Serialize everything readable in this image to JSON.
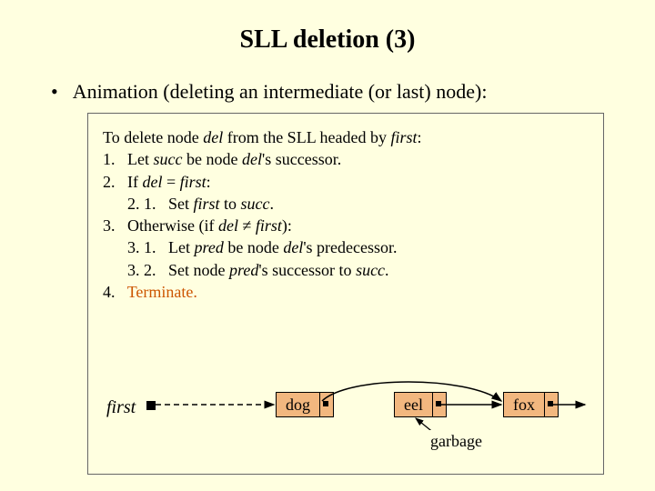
{
  "title": "SLL deletion (3)",
  "bullet": "Animation (deleting an intermediate (or last) node):",
  "algo": {
    "intro_pre": "To delete node ",
    "intro_del": "del",
    "intro_mid": " from the SLL headed by ",
    "intro_first": "first",
    "intro_post": ":",
    "l1_pre": "1.   Let ",
    "l1_succ": "succ",
    "l1_mid": " be node ",
    "l1_del": "del",
    "l1_post": "'s successor.",
    "l2_pre": "2.   If ",
    "l2_del": "del",
    "l2_eq": " = ",
    "l2_first": "first",
    "l2_post": ":",
    "l21_pre": "      2. 1.   Set ",
    "l21_first": "first",
    "l21_mid": " to ",
    "l21_succ": "succ",
    "l21_post": ".",
    "l3_pre": "3.   Otherwise (if ",
    "l3_del": "del",
    "l3_neq": " ≠ ",
    "l3_first": "first",
    "l3_post": "):",
    "l31_pre": "      3. 1.   Let ",
    "l31_pred": "pred",
    "l31_mid": " be node ",
    "l31_del": "del",
    "l31_post": "'s predecessor.",
    "l32_pre": "      3. 2.   Set node ",
    "l32_pred": "pred",
    "l32_mid": "'s successor to ",
    "l32_succ": "succ",
    "l32_post": ".",
    "l4_pre": "4.   ",
    "l4_term": "Terminate."
  },
  "diagram": {
    "first_label": "first",
    "nodes": [
      "dog",
      "eel",
      "fox"
    ],
    "garbage_label": "garbage"
  }
}
